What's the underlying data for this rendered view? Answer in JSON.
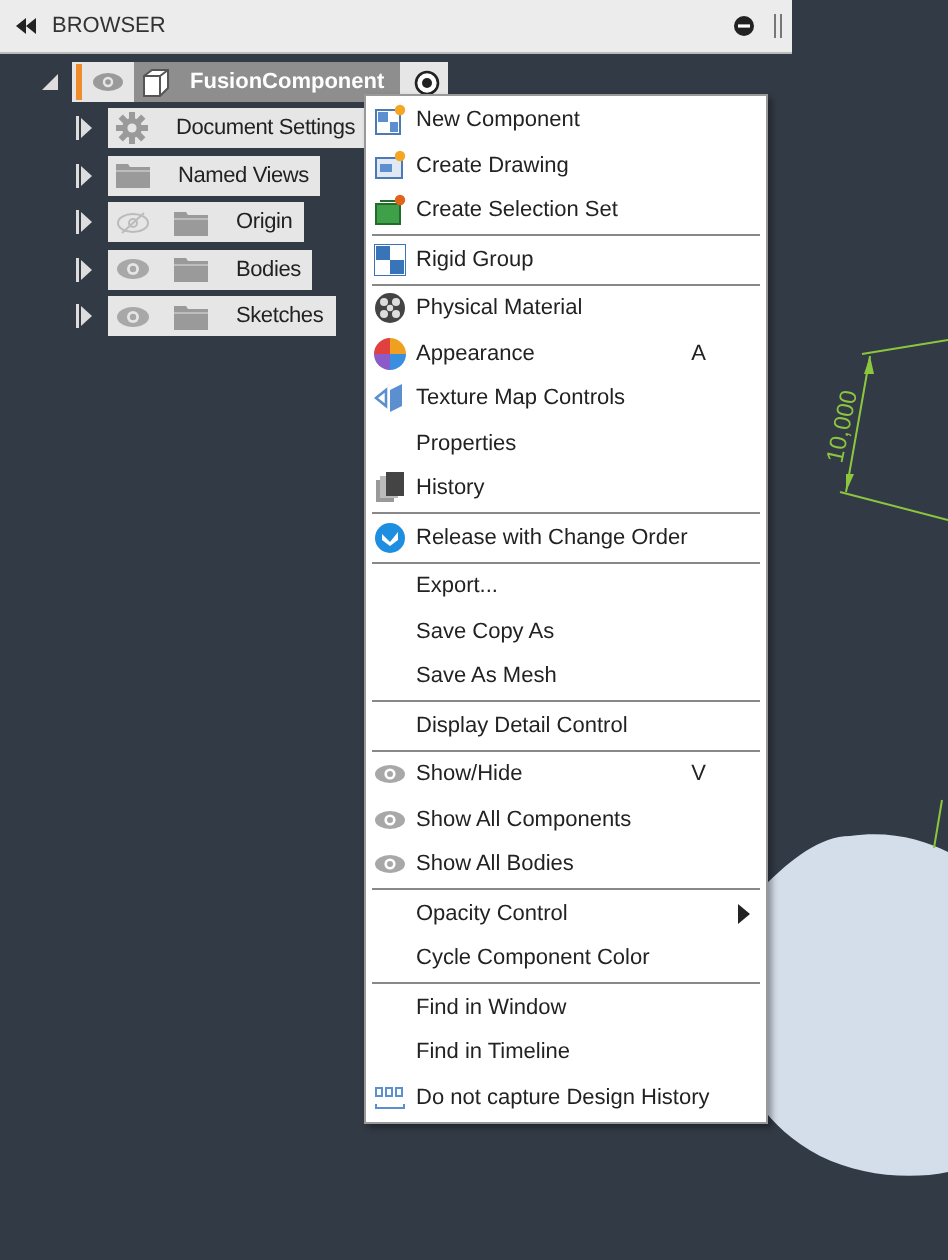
{
  "browser": {
    "title": "BROWSER",
    "root": {
      "label": "FusionComponent",
      "active": true,
      "visible": true,
      "children": [
        {
          "label": "Document Settings",
          "kind": "settings"
        },
        {
          "label": "Named Views",
          "kind": "folder"
        },
        {
          "label": "Origin",
          "kind": "toggle-folder",
          "visible": false
        },
        {
          "label": "Bodies",
          "kind": "toggle-folder",
          "visible": true
        },
        {
          "label": "Sketches",
          "kind": "toggle-folder",
          "visible": true
        }
      ]
    }
  },
  "context_menu": {
    "groups": [
      [
        {
          "label": "New Component"
        },
        {
          "label": "Create Drawing"
        },
        {
          "label": "Create Selection Set"
        }
      ],
      [
        {
          "label": "Rigid Group"
        }
      ],
      [
        {
          "label": "Physical Material"
        },
        {
          "label": "Appearance",
          "shortcut": "A"
        },
        {
          "label": "Texture Map Controls"
        },
        {
          "label": "Properties"
        },
        {
          "label": "History"
        }
      ],
      [
        {
          "label": "Release with Change Order"
        }
      ],
      [
        {
          "label": "Export..."
        },
        {
          "label": "Save Copy As"
        },
        {
          "label": "Save As Mesh"
        }
      ],
      [
        {
          "label": "Display Detail Control"
        }
      ],
      [
        {
          "label": "Show/Hide",
          "shortcut": "V"
        },
        {
          "label": "Show All Components"
        },
        {
          "label": "Show All Bodies"
        }
      ],
      [
        {
          "label": "Opacity Control",
          "submenu": true
        },
        {
          "label": "Cycle Component Color"
        }
      ],
      [
        {
          "label": "Find in Window"
        },
        {
          "label": "Find in Timeline"
        },
        {
          "label": "Do not capture Design History"
        }
      ]
    ]
  },
  "viewport": {
    "dimension": "10,000"
  }
}
